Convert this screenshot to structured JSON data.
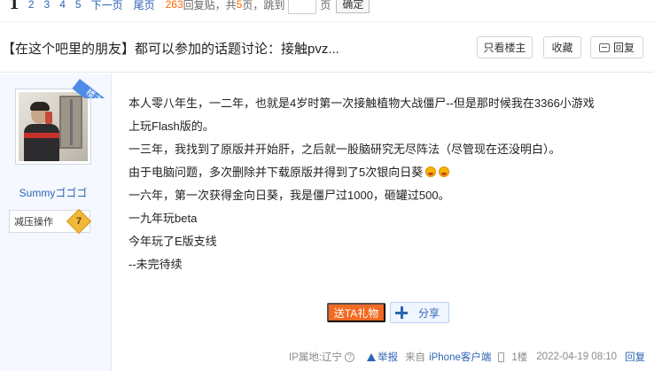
{
  "pager": {
    "current_page": "1",
    "pages": [
      "2",
      "3",
      "4",
      "5"
    ],
    "next_label": "下一页",
    "last_label": "尾页",
    "reply_count": "263",
    "reply_count_suffix": "回复贴，共",
    "total_pages": "5",
    "total_pages_suffix": "页，跳到",
    "page_unit": "页",
    "jump_value": "",
    "confirm_label": "确定"
  },
  "thread": {
    "title": "【在这个吧里的朋友】都可以参加的话题讨论：接触pvz...",
    "only_op_label": "只看楼主",
    "favorite_label": "收藏",
    "reply_label": "回复"
  },
  "author": {
    "username": "Summyゴゴゴ",
    "level_title": "减压操作",
    "level_number": "7",
    "op_ribbon": "楼主",
    "avatar_icon": "user-photo-avatar"
  },
  "post": {
    "lines": [
      "本人零八年生，一二年，也就是4岁时第一次接触植物大战僵尸--但是那时候我在3366小游戏",
      "上玩Flash版的。",
      "一三年，我找到了原版并开始肝，之后就一股脑研究无尽阵法（尽管现在还没明白）。",
      "由于电脑问题，多次删除并下载原版并得到了5次银向日葵",
      "一六年，第一次获得金向日葵，我是僵尸过1000，砸罐过500。",
      "一九年玩beta",
      "今年玩了E版支线",
      "--未完待续"
    ],
    "emoji_name": "laughing-emoji"
  },
  "actions": {
    "gift_label": "送TA礼物",
    "share_label": "分享"
  },
  "tail": {
    "ip_location": "IP属地:辽宁",
    "report_label": "举报",
    "from_label": "来自",
    "client_label": "iPhone客户端",
    "floor": "1楼",
    "time": "2022-04-19 08:10",
    "reply_label": "回复"
  },
  "colors": {
    "link": "#2d64b3",
    "gift_orange": "#f26a21",
    "ribbon_blue": "#4d8ce8",
    "highlight_red": "#f60"
  }
}
